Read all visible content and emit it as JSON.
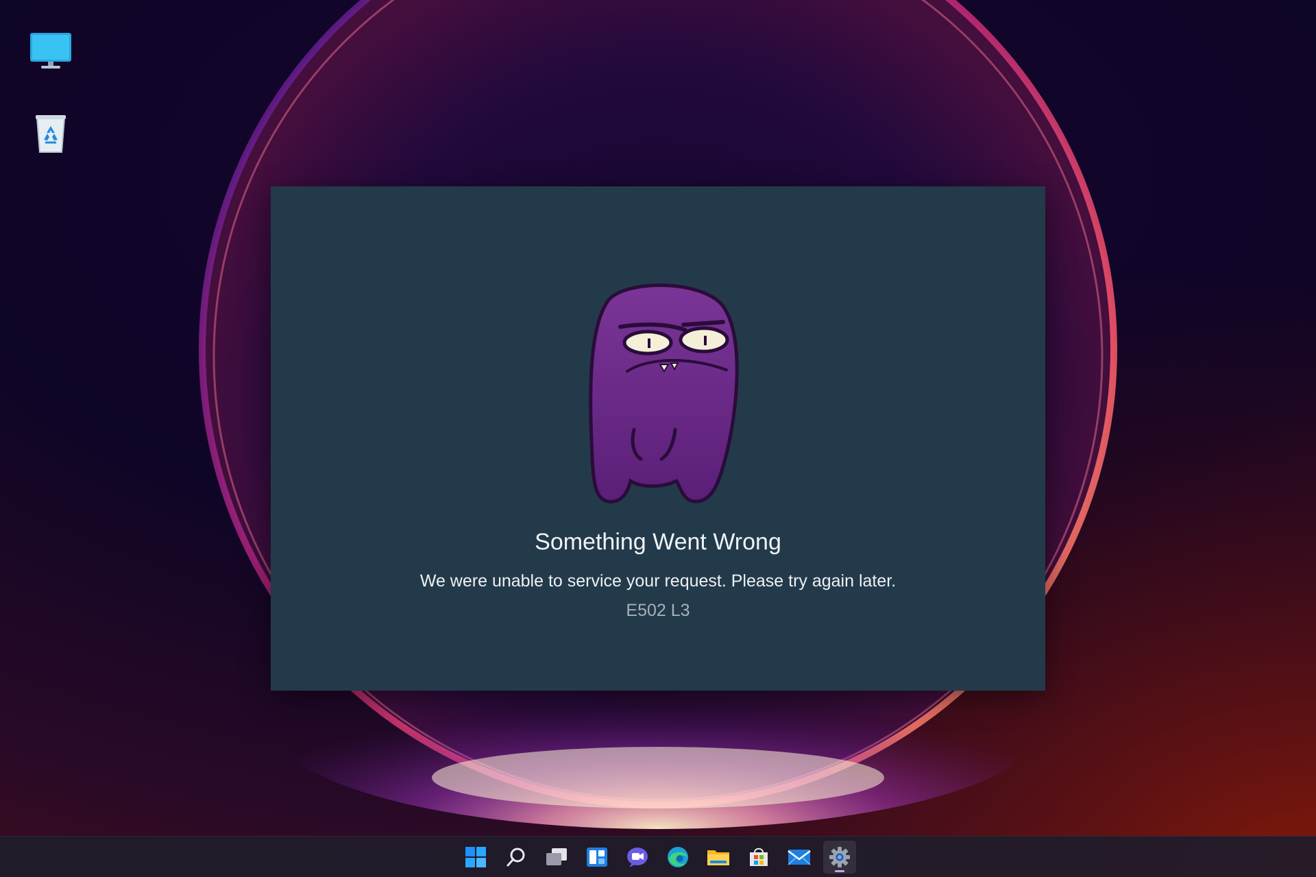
{
  "desktop": {
    "icons": [
      {
        "name": "this-pc",
        "icon": "monitor-icon"
      },
      {
        "name": "recycle-bin",
        "icon": "recycle-bin-icon"
      }
    ]
  },
  "error_dialog": {
    "title": "Something Went Wrong",
    "message": "We were unable to service your request. Please try again later.",
    "code": "E502 L3",
    "mascot_color": "#6a2b86",
    "background_color": "#233a4b"
  },
  "taskbar": {
    "items": [
      {
        "name": "start",
        "icon": "windows-start-icon"
      },
      {
        "name": "search",
        "icon": "search-icon"
      },
      {
        "name": "task-view",
        "icon": "task-view-icon"
      },
      {
        "name": "widgets",
        "icon": "widgets-icon"
      },
      {
        "name": "teams-chat",
        "icon": "teams-chat-icon"
      },
      {
        "name": "edge",
        "icon": "edge-browser-icon"
      },
      {
        "name": "file-explorer",
        "icon": "folder-icon"
      },
      {
        "name": "microsoft-store",
        "icon": "store-icon"
      },
      {
        "name": "mail",
        "icon": "mail-icon"
      },
      {
        "name": "settings",
        "icon": "gear-icon",
        "active": true
      }
    ]
  }
}
